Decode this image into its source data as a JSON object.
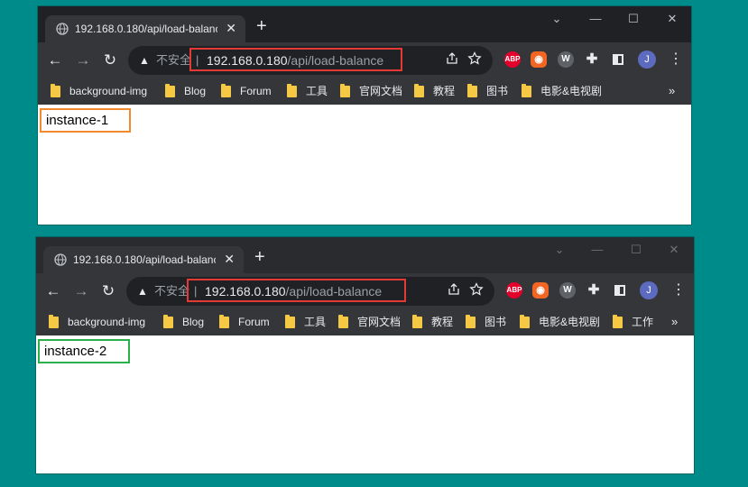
{
  "windows": [
    {
      "tab_title": "192.168.0.180/api/load-balance",
      "new_tab": "+",
      "controls": {
        "minimize": "—",
        "maximize": "☐",
        "close": "✕",
        "dropdown": "⌄"
      },
      "nav": {
        "back": "←",
        "forward": "→",
        "reload": "↻"
      },
      "address": {
        "warning": "▲",
        "insecure_label": "不安全",
        "separator": "|",
        "host": "192.168.0.180",
        "path": "/api/load-balance",
        "highlight_color": "#e53935"
      },
      "extensions": {
        "abp": "ABP",
        "w": "W",
        "avatar": "J",
        "menu": "⋮"
      },
      "bookmarks": [
        "background-img",
        "Blog",
        "Forum",
        "工具",
        "官网文档",
        "教程",
        "图书",
        "电影&电视剧"
      ],
      "bookmarks_more": "»",
      "content_text": "instance-1",
      "content_border_color": "#f28a2e"
    },
    {
      "tab_title": "192.168.0.180/api/load-balance",
      "new_tab": "+",
      "controls": {
        "minimize": "—",
        "maximize": "☐",
        "close": "✕",
        "dropdown": "⌄"
      },
      "nav": {
        "back": "←",
        "forward": "→",
        "reload": "↻"
      },
      "address": {
        "warning": "▲",
        "insecure_label": "不安全",
        "separator": "|",
        "host": "192.168.0.180",
        "path": "/api/load-balance",
        "highlight_color": "#e53935"
      },
      "extensions": {
        "abp": "ABP",
        "w": "W",
        "avatar": "J",
        "menu": "⋮"
      },
      "bookmarks": [
        "background-img",
        "Blog",
        "Forum",
        "工具",
        "官网文档",
        "教程",
        "图书",
        "电影&电视剧",
        "工作"
      ],
      "bookmarks_more": "»",
      "content_text": "instance-2",
      "content_border_color": "#2bb04c"
    }
  ],
  "colors": {
    "desktop": "#008B8B",
    "tabstrip": "#202124",
    "toolbar": "#35363a"
  }
}
